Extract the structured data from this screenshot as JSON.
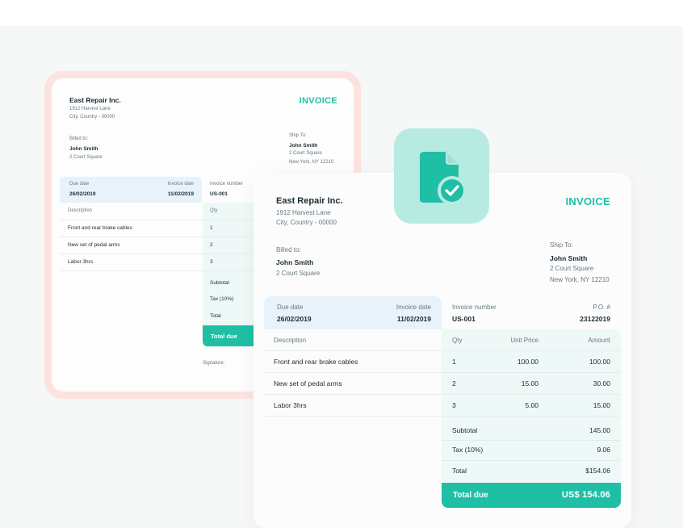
{
  "colors": {
    "accent": "#1fbfa5",
    "highlight_blue": "#e7f2fb",
    "back_frame": "#fde3df",
    "icon_bg": "#b7ebe1"
  },
  "back_invoice": {
    "company": "East Repair Inc.",
    "address_line1": "1912 Harvest Lane",
    "address_line2": "City, Country - 00000",
    "title": "INVOICE",
    "billed_label": "Billed to:",
    "billed_name": "John Smith",
    "billed_address": "2 Court Square",
    "ship_label": "Ship To:",
    "ship_name": "John Smith",
    "ship_address1": "2 Court Square",
    "ship_address2": "New York, NY 12210",
    "due_label": "Due date",
    "due_value": "26/02/2019",
    "invoice_date_label": "Invoice date",
    "invoice_date_value": "11/02/2019",
    "invoice_number_label": "Invoice number",
    "invoice_number_value": "US-001",
    "col_description": "Description",
    "col_qty": "Qty",
    "items": [
      {
        "description": "Front and rear brake cables",
        "qty": "1"
      },
      {
        "description": "New set of pedal arms",
        "qty": "2"
      },
      {
        "description": "Labor 3hrs",
        "qty": "3"
      }
    ],
    "subtotal_label": "Subtotal",
    "tax_label": "Tax (10%)",
    "total_label": "Total",
    "total_due_label": "Total due",
    "signature_label": "Signature:"
  },
  "front_invoice": {
    "company": "East Repair Inc.",
    "address_line1": "1912 Harvest Lane",
    "address_line2": "City, Country - 00000",
    "title": "INVOICE",
    "billed_label": "Billed to:",
    "billed_name": "John Smith",
    "billed_address": "2 Court Square",
    "ship_label": "Ship To:",
    "ship_name": "John Smith",
    "ship_address1": "2 Court Square",
    "ship_address2": "New York, NY 12210",
    "due_label": "Due date",
    "due_value": "26/02/2019",
    "invoice_date_label": "Invoice date",
    "invoice_date_value": "11/02/2019",
    "invoice_number_label": "Invoice number",
    "invoice_number_value": "US-001",
    "po_label": "P.O. #",
    "po_value": "23122019",
    "col_description": "Description",
    "col_qty": "Qty",
    "col_unit_price": "Unit Price",
    "col_amount": "Amount",
    "items": [
      {
        "description": "Front and rear brake cables",
        "qty": "1",
        "unit_price": "100.00",
        "amount": "100.00"
      },
      {
        "description": "New set of pedal arms",
        "qty": "2",
        "unit_price": "15.00",
        "amount": "30.00"
      },
      {
        "description": "Labor 3hrs",
        "qty": "3",
        "unit_price": "5.00",
        "amount": "15.00"
      }
    ],
    "subtotal_label": "Subtotal",
    "subtotal_value": "145.00",
    "tax_label": "Tax (10%)",
    "tax_value": "9.06",
    "total_label": "Total",
    "total_value": "$154.06",
    "total_due_label": "Total due",
    "total_due_value": "US$ 154.06"
  },
  "badge_icon": "document-check-icon"
}
